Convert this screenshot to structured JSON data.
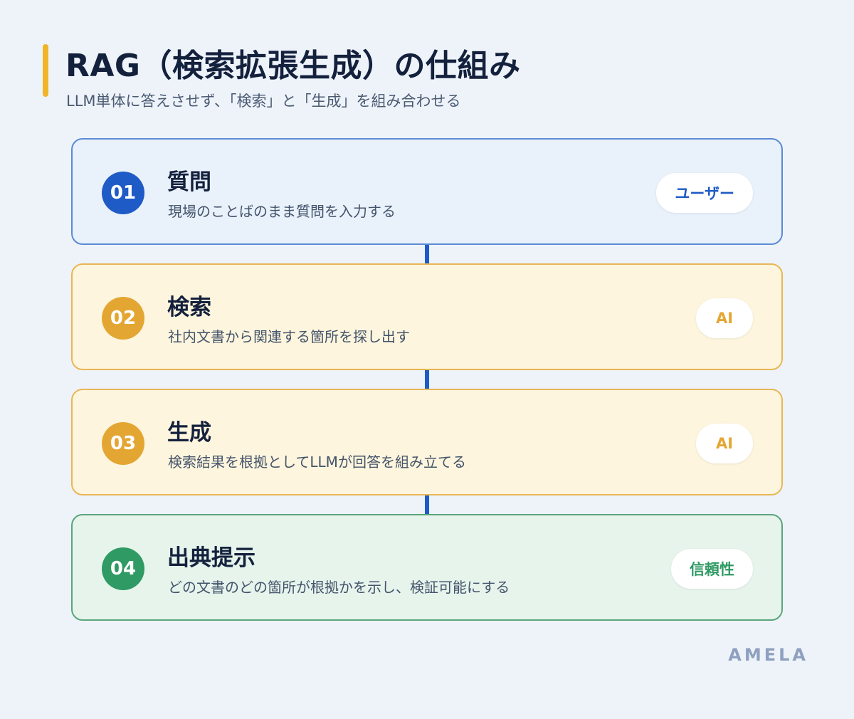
{
  "header": {
    "title": "RAG（検索拡張生成）の仕組み",
    "subtitle": "LLM単体に答えさせず、「検索」と「生成」を組み合わせる"
  },
  "steps": [
    {
      "number": "01",
      "title": "質問",
      "description": "現場のことばのまま質問を入力する",
      "badge": "ユーザー"
    },
    {
      "number": "02",
      "title": "検索",
      "description": "社内文書から関連する箇所を探し出す",
      "badge": "AI"
    },
    {
      "number": "03",
      "title": "生成",
      "description": "検索結果を根拠としてLLMが回答を組み立てる",
      "badge": "AI"
    },
    {
      "number": "04",
      "title": "出典提示",
      "description": "どの文書のどの箇所が根拠かを示し、検証可能にする",
      "badge": "信頼性"
    }
  ],
  "brand": "AMELA",
  "colors": {
    "accent": "#f0b429",
    "user": "#1e5bc6",
    "ai": "#e4a632",
    "trust": "#2f9a63"
  }
}
